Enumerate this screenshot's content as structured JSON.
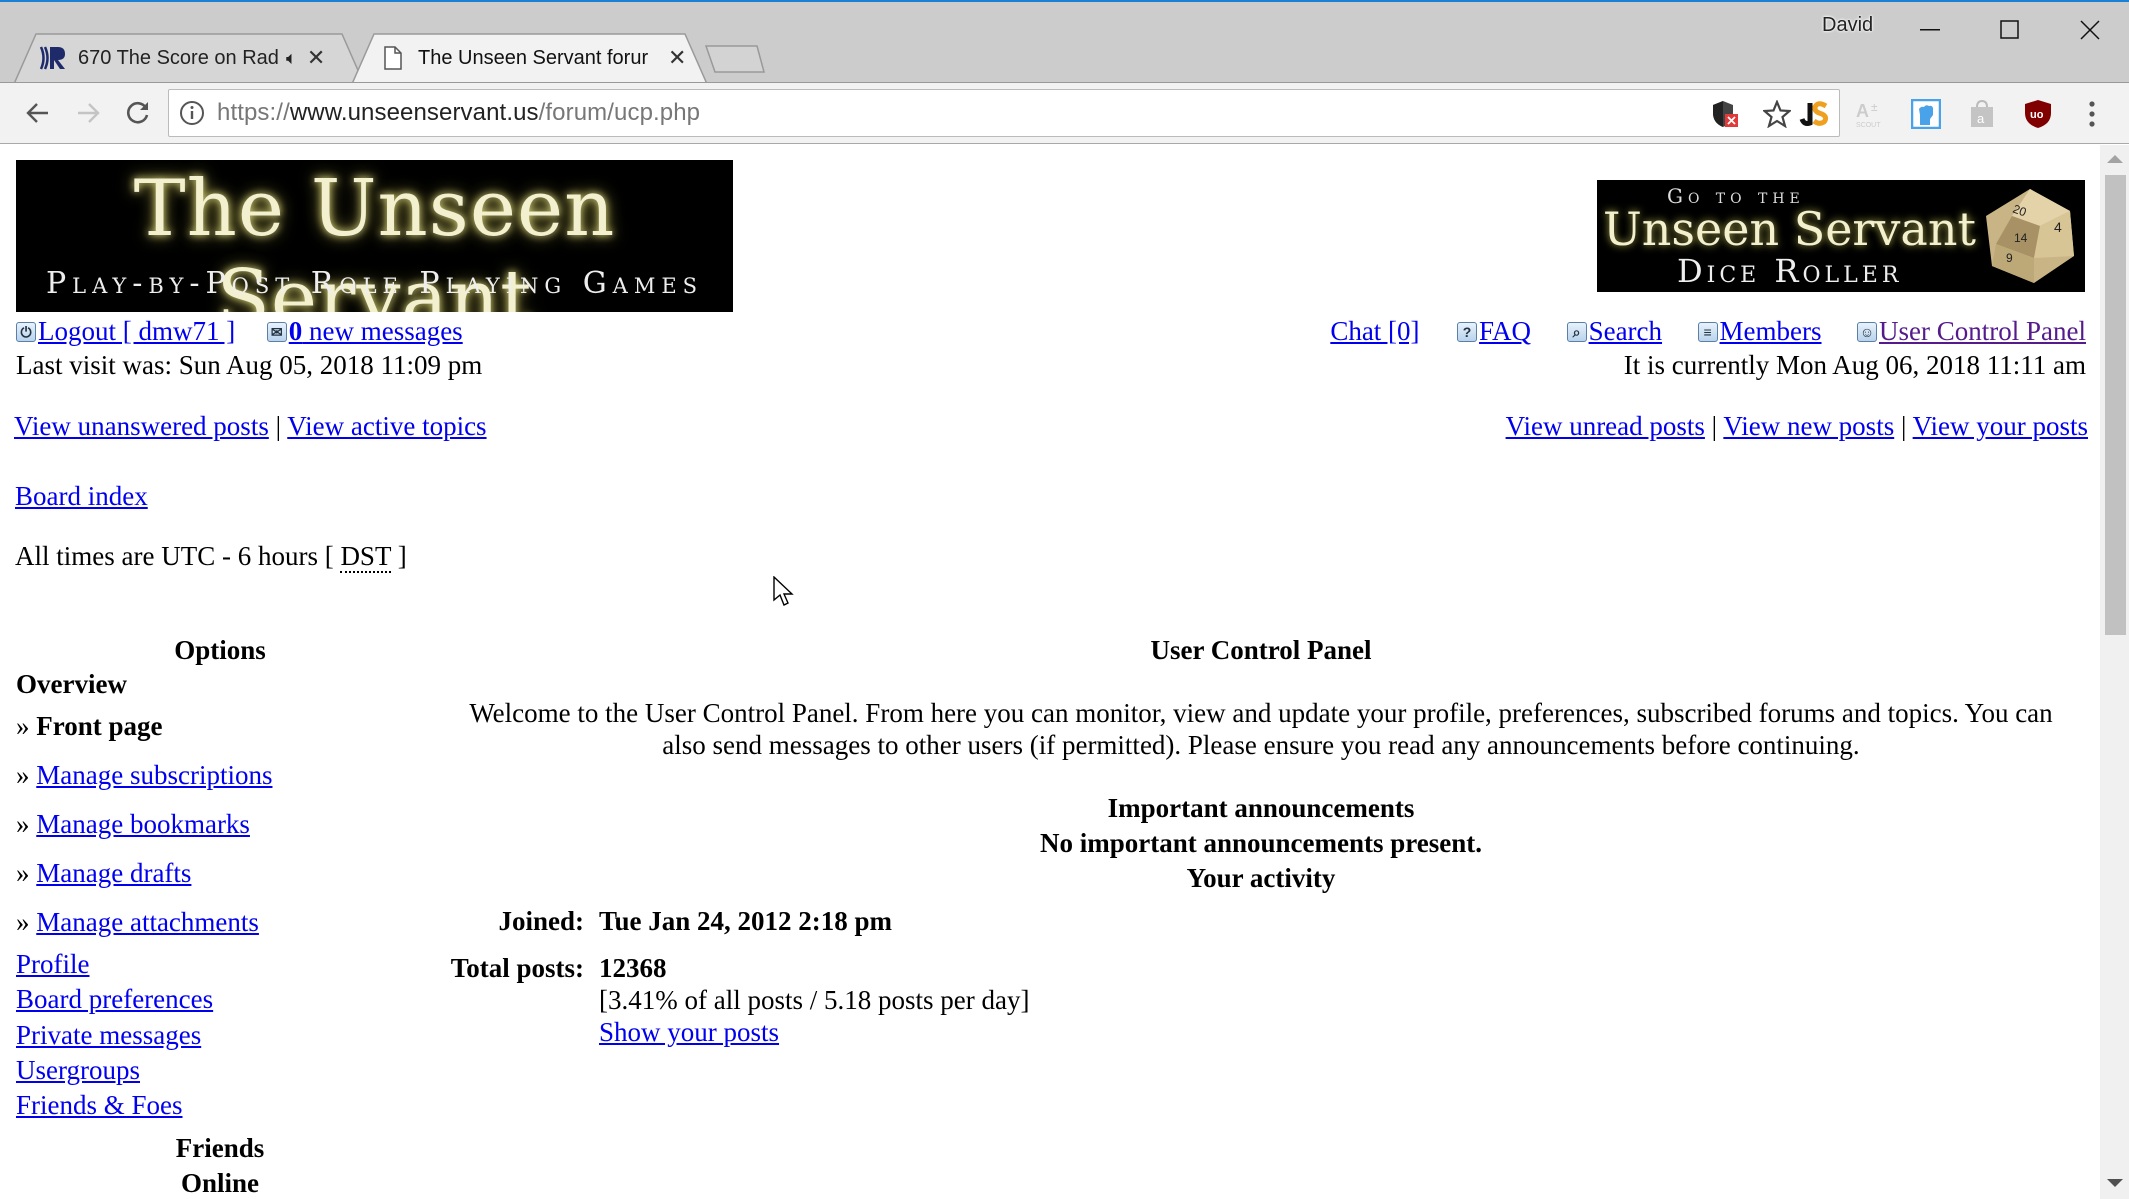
{
  "browser": {
    "profile_name": "David",
    "tabs": [
      {
        "title": "670 The Score on Rad",
        "favicon": "radio-r-icon",
        "audio": true,
        "active": false
      },
      {
        "title": "The Unseen Servant forur",
        "favicon": "page-icon",
        "active": true
      }
    ],
    "url": {
      "scheme": "https://",
      "host": "www.unseenservant.us",
      "path": "/forum/ucp.php"
    },
    "extensions": [
      "js-pro-icon",
      "a-scout-icon",
      "fist-icon",
      "amazon-bag-icon",
      "ublock-icon"
    ]
  },
  "header": {
    "logo_title": "The Unseen Servant",
    "logo_subtitle": "Play-by-Post Role Playing Games",
    "dice_banner": {
      "line1": "Go to the",
      "line2": "Unseen Servant",
      "line3": "Dice Roller"
    },
    "logout_label": "Logout [ dmw71 ]",
    "messages_count": "0",
    "messages_label": " new messages",
    "last_visit": "Last visit was: Sun Aug 05, 2018 11:09 pm",
    "current_time": "It is currently Mon Aug 06, 2018 11:11 am",
    "nav": {
      "chat": "Chat [0]",
      "faq": "FAQ",
      "search": "Search",
      "members": "Members",
      "ucp": "User Control Panel"
    },
    "quick_links_left": [
      "View unanswered posts",
      "View active topics"
    ],
    "quick_links_right": [
      "View unread posts",
      "View new posts",
      "View your posts"
    ],
    "separator": "|",
    "breadcrumb": "Board index",
    "timezone_prefix": "All times are UTC - 6 hours [ ",
    "timezone_dst": "DST",
    "timezone_suffix": " ]"
  },
  "sidebar": {
    "heading": "Options",
    "section": "Overview",
    "bullet": "» ",
    "items": [
      {
        "label": "Front page",
        "active": true
      },
      {
        "label": "Manage subscriptions"
      },
      {
        "label": "Manage bookmarks"
      },
      {
        "label": "Manage drafts"
      },
      {
        "label": "Manage attachments"
      }
    ],
    "tabs": [
      "Profile",
      "Board preferences",
      "Private messages",
      "Usergroups",
      "Friends & Foes"
    ],
    "friends_heading_1": "Friends",
    "friends_heading_2": "Online"
  },
  "main": {
    "title": "User Control Panel",
    "welcome_line1": "Welcome to the User Control Panel. From here you can monitor, view and update your profile, preferences, subscribed forums and topics. You can",
    "welcome_line2": "also send messages to other users (if permitted). Please ensure you read any announcements before continuing.",
    "announcements_heading": "Important announcements",
    "announcements_empty": "No important announcements present.",
    "activity_heading": "Your activity",
    "joined_label": "Joined:",
    "joined_value": "Tue Jan 24, 2012 2:18 pm",
    "posts_label": "Total posts:",
    "posts_value": "12368",
    "posts_stats": "[3.41% of all posts / 5.18 posts per day]",
    "show_posts": "Show your posts"
  }
}
